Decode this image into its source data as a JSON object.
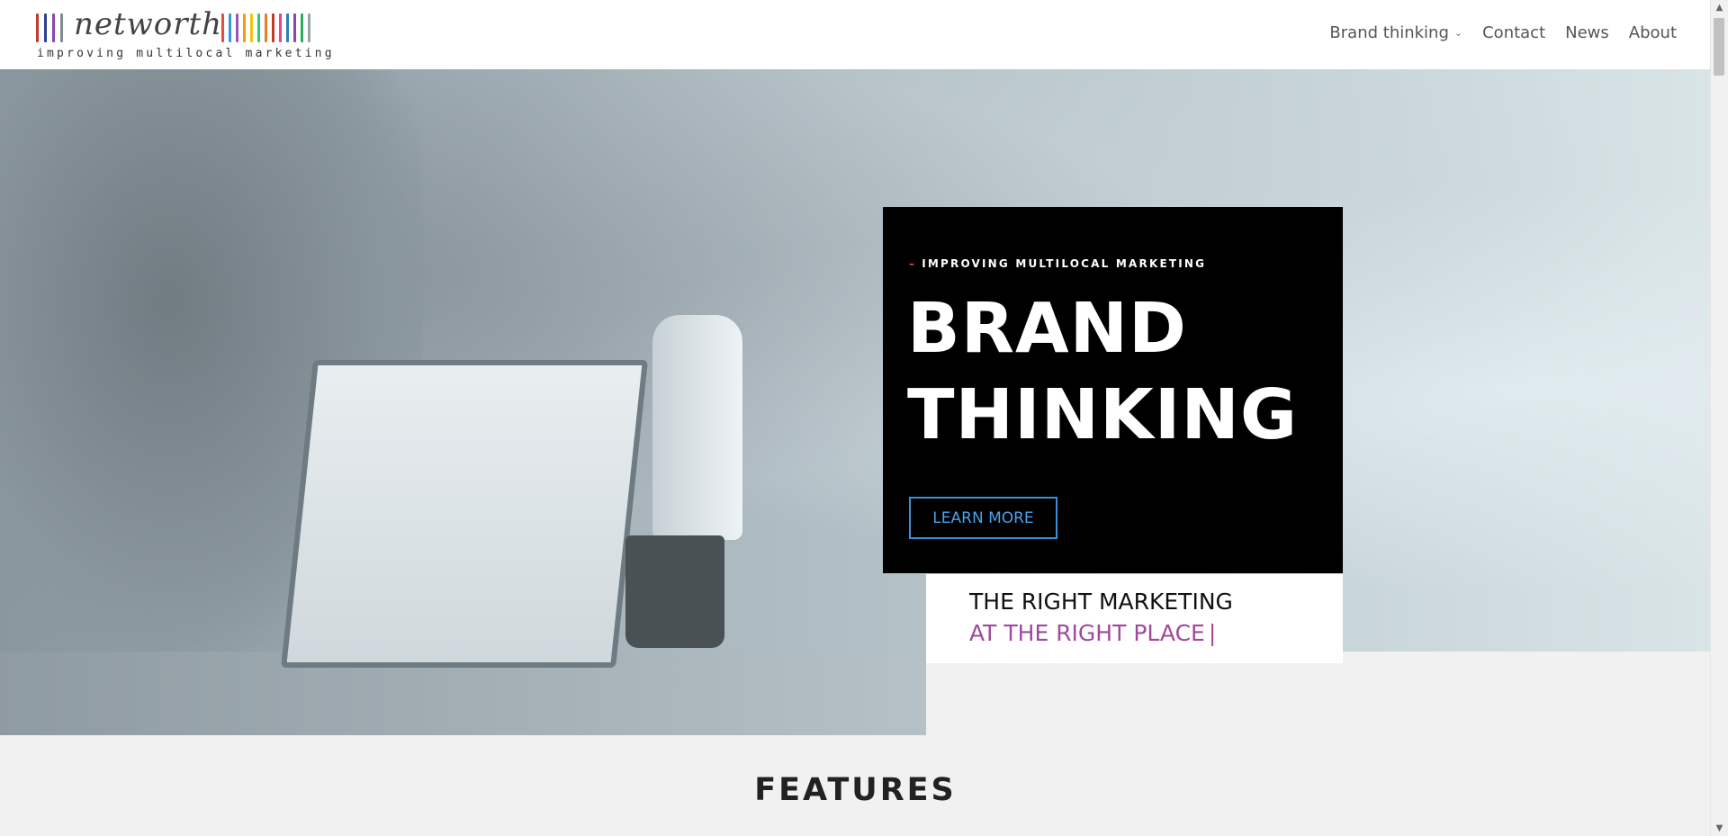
{
  "logo": {
    "wordmark": "networth",
    "tagline": "improving multilocal marketing",
    "bar_colors": [
      "#c0392b",
      "#2c3e91",
      "#8e44ad",
      "#7f8c8d",
      "#e74c3c",
      "#3498db",
      "#9b59b6",
      "#f39c12",
      "#f1c40f",
      "#2ecc71",
      "#e67e22",
      "#c0392b",
      "#e84393",
      "#2980b9",
      "#8e44ad",
      "#27ae60",
      "#95a5a6"
    ]
  },
  "nav": {
    "items": [
      {
        "label": "Brand thinking",
        "has_dropdown": true
      },
      {
        "label": "Contact"
      },
      {
        "label": "News"
      },
      {
        "label": "About"
      }
    ]
  },
  "hero": {
    "eyebrow": "IMPROVING MULTILOCAL MARKETING",
    "title_line1": "BRAND",
    "title_line2": "THINKING",
    "cta_label": "LEARN MORE",
    "tagline_line1": "THE RIGHT MARKETING",
    "tagline_line2": "AT THE RIGHT PLACE",
    "accent_color": "#a24a9a",
    "button_color": "#3b8fd9"
  },
  "section": {
    "features_heading": "FEATURES"
  }
}
